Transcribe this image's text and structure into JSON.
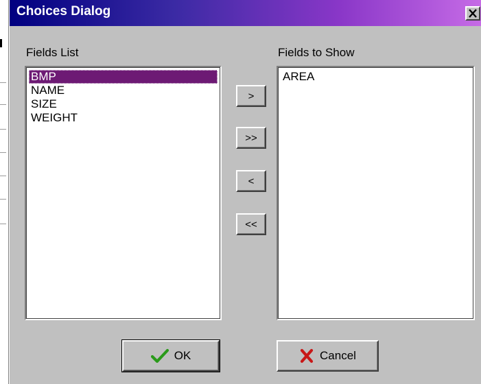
{
  "dialog": {
    "title": "Choices Dialog",
    "close_label": "close"
  },
  "fields_list": {
    "label": "Fields List",
    "items": [
      "BMP",
      "NAME",
      "SIZE",
      "WEIGHT"
    ],
    "selected": "BMP"
  },
  "fields_to_show": {
    "label": "Fields to Show",
    "items": [
      "AREA"
    ]
  },
  "move_buttons": {
    "add_one": ">",
    "add_all": ">>",
    "remove_one": "<",
    "remove_all": "<<"
  },
  "footer": {
    "ok_label": "OK",
    "cancel_label": "Cancel"
  },
  "colors": {
    "title_gradient_start": "#000080",
    "title_gradient_end": "#c66be6",
    "selection": "#6d1a74",
    "ok_icon": "#2a9a1a",
    "cancel_icon": "#c81818"
  },
  "icons": {
    "ok": "checkmark-icon",
    "cancel": "x-mark-icon",
    "close": "close-icon"
  }
}
